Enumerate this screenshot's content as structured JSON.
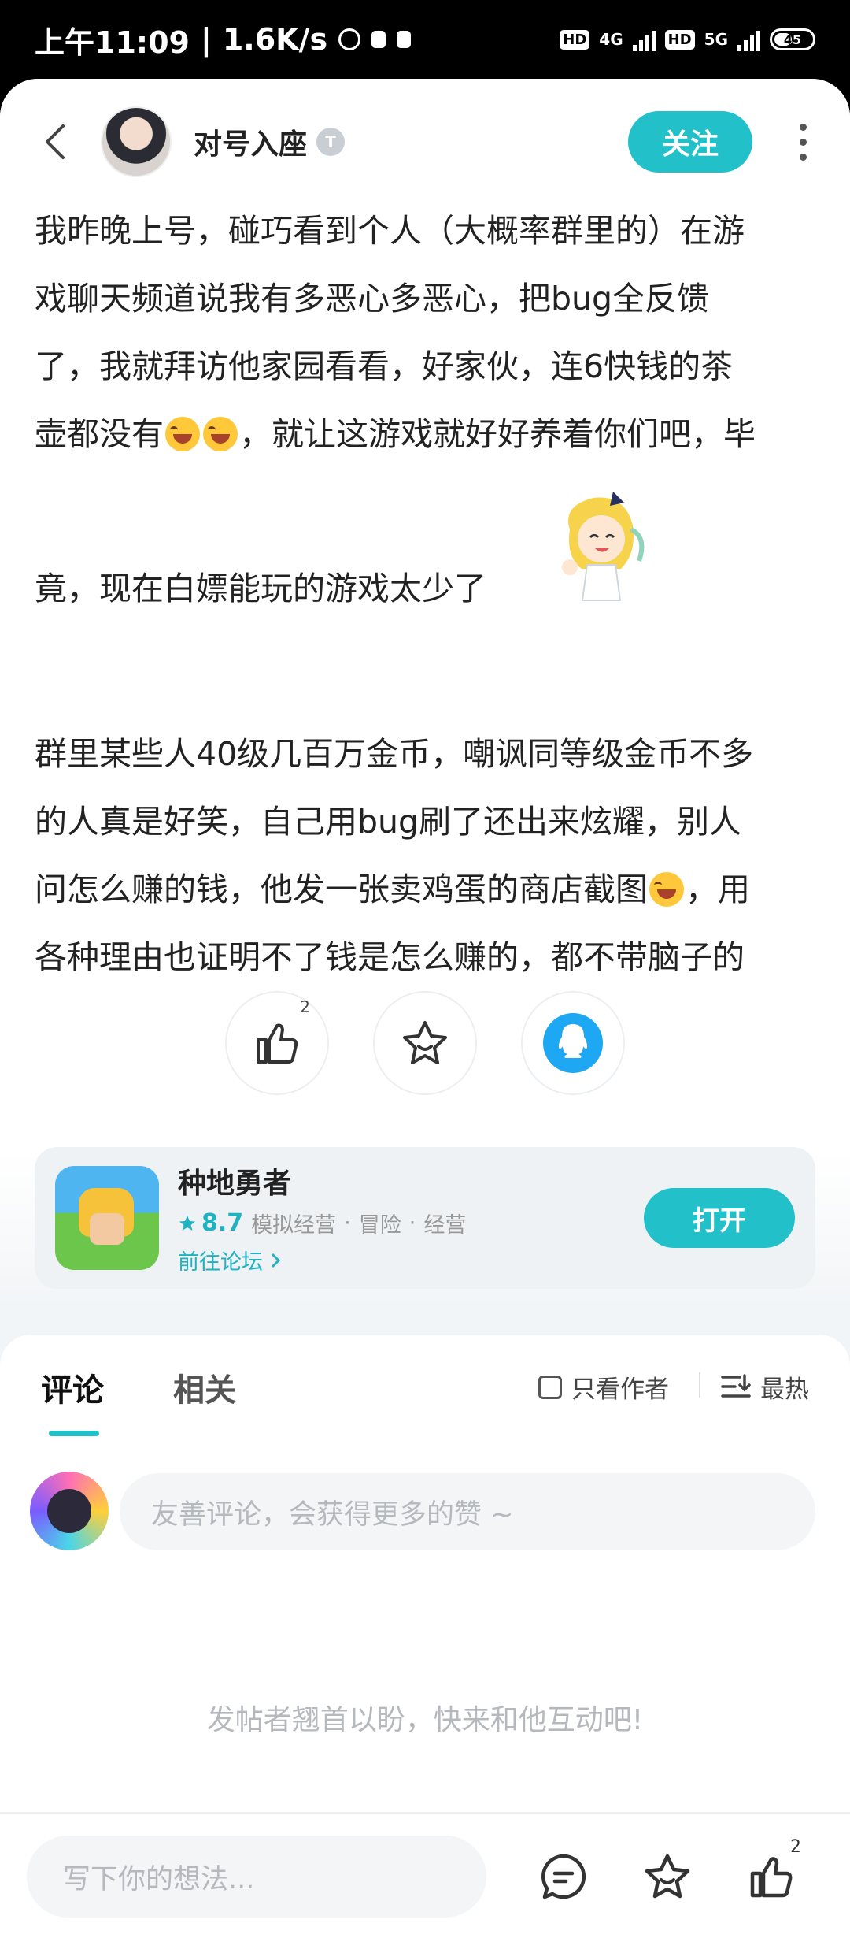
{
  "status_bar": {
    "time": "上午11:09",
    "speed": "1.6K/s",
    "net1": "4G",
    "net2": "5G",
    "hd": "HD",
    "battery": "45"
  },
  "header": {
    "author_name": "对号入座",
    "level_badge": "T",
    "follow_label": "关注"
  },
  "post": {
    "lines": [
      "我昨晚上号，碰巧看到个人（大概率群里的）在游",
      "戏聊天频道说我有多恶心多恶心，把bug全反馈",
      "了，我就拜访他家园看看，好家伙，连6快钱的茶"
    ],
    "line4_before": "壶都没有",
    "line4_after": "，就让这游戏就好好养着你们吧，毕",
    "line5": "竟，现在白嫖能玩的游戏太少了",
    "para2_line1": "群里某些人40级几百万金币，嘲讽同等级金币不多",
    "para2_line2": "的人真是好笑，自己用bug刷了还出来炫耀，别人",
    "para2_line3_before": "问怎么赚的钱，他发一张卖鸡蛋的商店截图",
    "para2_line3_after": "，用",
    "para2_line4": "各种理由也证明不了钱是怎么赚的，都不带脑子的"
  },
  "actions": {
    "like_count": "2",
    "like_icon": "thumbs-up-icon",
    "favorite_icon": "star-icon",
    "share_icon": "qq-icon"
  },
  "app_card": {
    "name": "种地勇者",
    "rating": "8.7",
    "tag1": "模拟经营",
    "tag2": "冒险",
    "tag3": "经营",
    "separator": "·",
    "forum_link": "前往论坛",
    "open_label": "打开"
  },
  "comments": {
    "tab_comments": "评论",
    "tab_related": "相关",
    "author_only": "只看作者",
    "sort_label": "最热",
    "input_placeholder": "友善评论，会获得更多的赞 ~",
    "empty_hint": "发帖者翘首以盼，快来和他互动吧!"
  },
  "bottom_bar": {
    "input_placeholder": "写下你的想法...",
    "like_count": "2"
  },
  "colors": {
    "accent": "#22c0c8",
    "link": "#20b2c0"
  }
}
